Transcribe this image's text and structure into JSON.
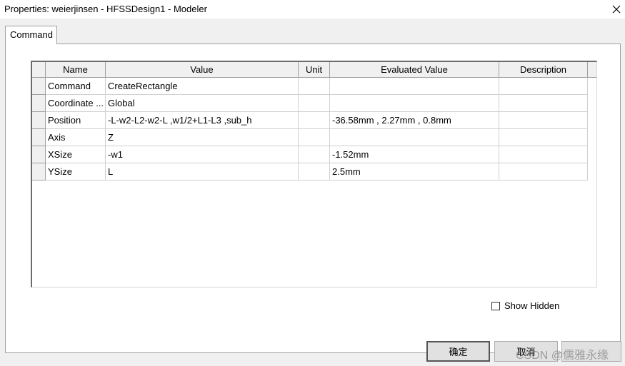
{
  "window": {
    "title": "Properties: weierjinsen - HFSSDesign1 - Modeler"
  },
  "tabs": [
    {
      "label": "Command"
    }
  ],
  "table": {
    "columns": [
      "Name",
      "Value",
      "Unit",
      "Evaluated Value",
      "Description"
    ],
    "rows": [
      {
        "name": "Command",
        "value": "CreateRectangle",
        "unit": "",
        "evaluated": "",
        "description": ""
      },
      {
        "name": "Coordinate ...",
        "value": "Global",
        "unit": "",
        "evaluated": "",
        "description": ""
      },
      {
        "name": "Position",
        "value": "-L-w2-L2-w2-L ,w1/2+L1-L3 ,sub_h",
        "unit": "",
        "evaluated": "-36.58mm , 2.27mm , 0.8mm",
        "description": ""
      },
      {
        "name": "Axis",
        "value": "Z",
        "unit": "",
        "evaluated": "",
        "description": ""
      },
      {
        "name": "XSize",
        "value": "-w1",
        "unit": "",
        "evaluated": "-1.52mm",
        "description": ""
      },
      {
        "name": "YSize",
        "value": "L",
        "unit": "",
        "evaluated": "2.5mm",
        "description": ""
      }
    ]
  },
  "options": {
    "show_hidden_label": "Show Hidden",
    "show_hidden_checked": false
  },
  "buttons": {
    "ok_label": "确定",
    "cancel_label": "取消"
  },
  "watermark": {
    "text": "CSDN @儒雅永缘"
  },
  "icons": {
    "close": "close-icon"
  }
}
